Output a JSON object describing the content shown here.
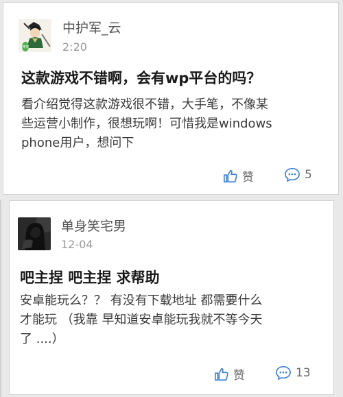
{
  "posts": [
    {
      "username": "中护军_云",
      "time": "2:20",
      "title": "这款游戏不错啊，会有wp平台的吗？",
      "body_lines": [
        "看介绍觉得这款游戏很不错，大手笔，不像某",
        "些运营小制作，很想玩啊！可惜我是windows",
        "phone用户，想问下"
      ],
      "like_label": "赞",
      "comment_count": "5",
      "avatar_icon": "warrior-avatar",
      "avatar_badge_text": "神将"
    },
    {
      "username": "单身笑宅男",
      "time": "12-04",
      "title": "吧主捏 吧主捏 求帮助",
      "body_lines": [
        "安卓能玩么？？ 有没有下载地址 都需要什么",
        "才能玩 （我靠 早知道安卓能玩我就不等今天",
        "了 ....）"
      ],
      "like_label": "赞",
      "comment_count": "13",
      "avatar_icon": "hooded-figure-avatar"
    }
  ],
  "colors": {
    "icon_blue": "#3d7fd6",
    "card_bg": "#ffffff",
    "page_bg": "#e9e9e9"
  }
}
